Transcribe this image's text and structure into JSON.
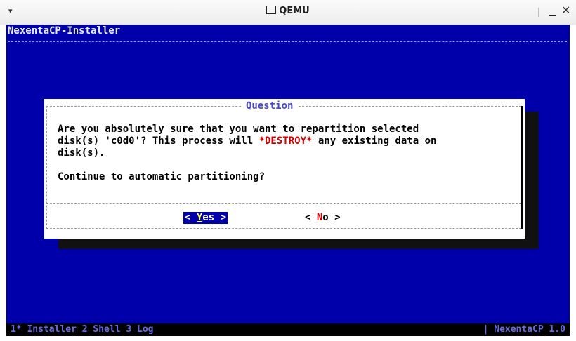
{
  "window": {
    "menu_glyph": "▾",
    "title": "QEMU",
    "close_glyph": "✕"
  },
  "console": {
    "app_title": "NexentaCP-Installer"
  },
  "dialog": {
    "title": "Question",
    "message_line1": "Are you absolutely sure that you want to repartition selected",
    "message_line2_pre": "disk(s) 'c0d0'? This process will ",
    "message_destroy": "*DESTROY*",
    "message_line2_post": " any existing data on",
    "message_line3": "disk(s).",
    "prompt": "Continue to automatic partitioning?",
    "yes_open": "< ",
    "yes_hot": "Y",
    "yes_rest": "es >",
    "no_open": "< ",
    "no_hot": "N",
    "no_rest": "o  >"
  },
  "statusbar": {
    "tabs": "1* Installer  2 Shell  3 Log",
    "right": "| NexentaCP 1.0"
  },
  "colors": {
    "screen_bg": "#0000aa",
    "dialog_bg": "#ffffff",
    "title_color": "#4848c8",
    "destroy_color": "#cc0000"
  }
}
